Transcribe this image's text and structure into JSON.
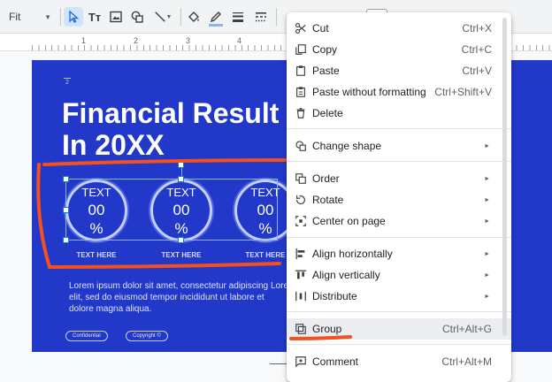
{
  "toolbar": {
    "zoom_value": "Fit",
    "tools": [
      {
        "name": "select-tool-icon",
        "active": true
      },
      {
        "name": "text-box-icon"
      },
      {
        "name": "image-icon"
      },
      {
        "name": "shape-icon"
      },
      {
        "name": "line-icon"
      },
      {
        "name": "fill-color-icon"
      },
      {
        "name": "border-color-icon"
      },
      {
        "name": "border-weight-icon"
      },
      {
        "name": "border-dash-icon"
      }
    ],
    "text_tool_label": "Tт"
  },
  "ruler": {
    "numbers": [
      "1",
      "2",
      "3",
      "4"
    ]
  },
  "slide": {
    "number": "2",
    "title_line1": "Financial Result",
    "title_line2": "In 20XX",
    "circles": [
      {
        "text": "TEXT",
        "value": "00",
        "unit": "%",
        "label": "TEXT HERE"
      },
      {
        "text": "TEXT",
        "value": "00",
        "unit": "%",
        "label": "TEXT HERE"
      },
      {
        "text": "TEXT",
        "value": "00",
        "unit": "%",
        "label": "TEXT HERE"
      }
    ],
    "body_text": "Lorem ipsum dolor sit amet, consectetur adipiscing elit, sed do eiusmod tempor incididunt ut labore et dolore magna aliqua.",
    "body_text_2": "Lore",
    "pills": [
      "Confidential",
      "Copyright ©"
    ]
  },
  "annotation_color": "#f4511e",
  "accent_color": "#2238c9",
  "context_menu": {
    "items": [
      {
        "icon": "cut-icon",
        "label": "Cut",
        "shortcut": "Ctrl+X"
      },
      {
        "icon": "copy-icon",
        "label": "Copy",
        "shortcut": "Ctrl+C"
      },
      {
        "icon": "paste-icon",
        "label": "Paste",
        "shortcut": "Ctrl+V"
      },
      {
        "icon": "paste-plain-icon",
        "label": "Paste without formatting",
        "shortcut": "Ctrl+Shift+V"
      },
      {
        "icon": "delete-icon",
        "label": "Delete",
        "shortcut": ""
      },
      {
        "icon": "change-shape-icon",
        "label": "Change shape",
        "submenu": true
      },
      {
        "icon": "order-icon",
        "label": "Order",
        "submenu": true
      },
      {
        "icon": "rotate-icon",
        "label": "Rotate",
        "submenu": true
      },
      {
        "icon": "center-icon",
        "label": "Center on page",
        "submenu": true
      },
      {
        "icon": "align-horizontal-icon",
        "label": "Align horizontally",
        "submenu": true
      },
      {
        "icon": "align-vertical-icon",
        "label": "Align vertically",
        "submenu": true
      },
      {
        "icon": "distribute-icon",
        "label": "Distribute",
        "submenu": true
      },
      {
        "icon": "group-icon",
        "label": "Group",
        "shortcut": "Ctrl+Alt+G",
        "highlighted": true
      },
      {
        "icon": "comment-icon",
        "label": "Comment",
        "shortcut": "Ctrl+Alt+M"
      }
    ],
    "submenu_arrow": "►"
  }
}
